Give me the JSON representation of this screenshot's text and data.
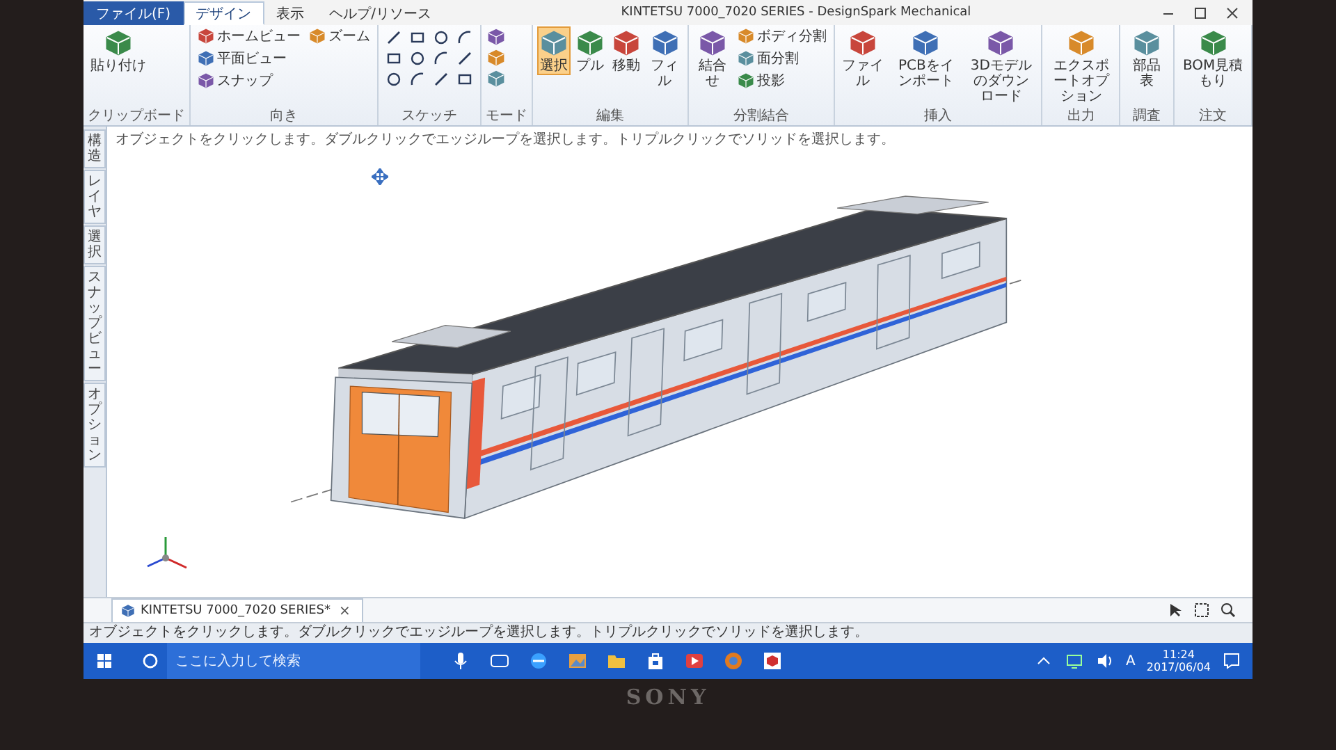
{
  "window": {
    "title": "KINTETSU 7000_7020 SERIES - DesignSpark Mechanical"
  },
  "ribbon_tabs": [
    {
      "label": "ファイル(F)",
      "selected": false
    },
    {
      "label": "デザイン",
      "selected": true
    },
    {
      "label": "表示",
      "selected": false
    },
    {
      "label": "ヘルプ/リソース",
      "selected": false
    }
  ],
  "ribbon_groups": [
    {
      "label": "クリップボード",
      "kind": "buttons",
      "buttons": [
        {
          "label": "貼り付け",
          "kind": "large"
        }
      ]
    },
    {
      "label": "向き",
      "kind": "buttons",
      "buttons": [
        {
          "label": "ホームビュー",
          "kind": "small"
        },
        {
          "label": "平面ビュー",
          "kind": "small"
        },
        {
          "label": "スナップ",
          "kind": "small"
        },
        {
          "label": "ズーム",
          "kind": "small"
        }
      ]
    },
    {
      "label": "スケッチ",
      "kind": "sketch"
    },
    {
      "label": "モード",
      "kind": "mode"
    },
    {
      "label": "編集",
      "kind": "buttons",
      "buttons": [
        {
          "label": "選択",
          "kind": "large",
          "selected": true
        },
        {
          "label": "プル",
          "kind": "large",
          "selected": false
        },
        {
          "label": "移動",
          "kind": "large",
          "selected": false
        },
        {
          "label": "フィル",
          "kind": "large",
          "selected": false
        }
      ]
    },
    {
      "label": "分割結合",
      "kind": "buttons",
      "buttons": [
        {
          "label": "結合せ",
          "kind": "large"
        },
        {
          "label": "ボディ分割",
          "kind": "small"
        },
        {
          "label": "面分割",
          "kind": "small"
        },
        {
          "label": "投影",
          "kind": "small"
        }
      ]
    },
    {
      "label": "挿入",
      "kind": "buttons",
      "buttons": [
        {
          "label": "ファイル",
          "kind": "large"
        },
        {
          "label": "PCBをインポート",
          "kind": "large"
        },
        {
          "label": "3Dモデルのダウンロード",
          "kind": "large"
        }
      ]
    },
    {
      "label": "出力",
      "kind": "buttons",
      "buttons": [
        {
          "label": "エクスポートオプション",
          "kind": "large"
        }
      ]
    },
    {
      "label": "調査",
      "kind": "buttons",
      "buttons": [
        {
          "label": "部品表",
          "kind": "large"
        }
      ]
    },
    {
      "label": "注文",
      "kind": "buttons",
      "buttons": [
        {
          "label": "BOM見積もり",
          "kind": "large"
        }
      ]
    }
  ],
  "hint": "オブジェクトをクリックします。ダブルクリックでエッジループを選択します。トリプルクリックでソリッドを選択します。",
  "side_tabs": [
    "構造",
    "レイヤ",
    "選択",
    "スナップビュー",
    "オプション"
  ],
  "document_tab": {
    "label": "KINTETSU 7000_7020 SERIES*",
    "close": "×"
  },
  "status_bar": "オブジェクトをクリックします。ダブルクリックでエッジループを選択します。トリプルクリックでソリッドを選択します。",
  "taskbar": {
    "search": {
      "placeholder": "ここに入力して検索"
    },
    "input_mode": "A",
    "time": "11:24",
    "date": "2017/06/04"
  },
  "bezel": {
    "brand": "SONY"
  }
}
